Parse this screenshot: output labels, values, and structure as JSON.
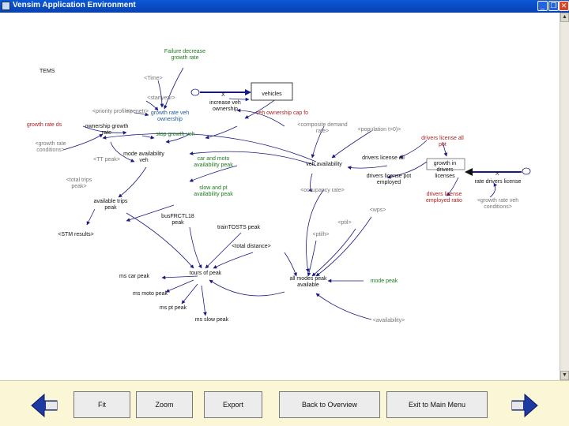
{
  "window": {
    "title": "Vensim Application Environment",
    "controls": [
      "_",
      "❐",
      "✕"
    ]
  },
  "model": {
    "title": "TEMS",
    "labels": {
      "failure_decrease": "Failure decrease\ngrowth rate",
      "time": "<Time>",
      "startyear": "<startyear>",
      "priority_profile": "<priority profile>",
      "growth_rate_veh": "growth rate veh\nownership",
      "penetr": "<penetr>",
      "stop_growth": "stop growth veh",
      "growth_rate_ds": "growth rate ds",
      "growth_rate_conditions": "<growth rate\nconditions>",
      "increase_veh": "increase veh\nownership",
      "vehicles": "vehicles",
      "veh_ownership": "veh ownership cap fo",
      "ownership_growth": "ownership growth\nrate",
      "composite_demand": "<composite demand\nrate>",
      "population": "<population t>0)>",
      "mode_availability": "mode availability\nveh",
      "car_and_moto": "car and moto\navailability peak",
      "slow_and_pt": "slow and pt\navailability peak",
      "tt_peak": "<TT peak>",
      "veh_availability": "veh availability",
      "drivers_license_all": "drivers license all",
      "drivers_license_pot": "drivers license pot\nemployed",
      "occupancy_rate": "<occupancy rate>",
      "drivers_license_total": "drivers license all\npot",
      "growth_drivers_licenses": "growth in\ndrivers\nlicenses",
      "rate_drivers_license": "rate drivers license",
      "drivers_license_employed": "drivers license\nemployed ratio",
      "growth_rate_veh_conditions": "<growth rate veh\nconditions>",
      "total_trips_peak": "<total trips\npeak>",
      "available_trips_peak": "available trips\npeak",
      "stm_results": "<STM results>",
      "bus_frc": "busFRCTL18\npeak",
      "train_peak": "trainTOSTS peak",
      "total_distance": "<total distance>",
      "tours_peak": "tours of peak",
      "wps": "<wps>",
      "ptil": "<ptil>",
      "ptilh": "<ptilh>",
      "all_modes_peak": "all modes peak\navailable",
      "mode_peak": "mode peak",
      "availability": "<availability>",
      "mscar_peak": "ms car peak",
      "msmoto_peak": "ms moto peak",
      "mspt_peak": "ms pt peak",
      "msslow_peak": "ms slow peak",
      "xmark": "X"
    }
  },
  "toolbar": {
    "back_arrow": "back",
    "fit": "Fit",
    "zoom": "Zoom",
    "export": "Export",
    "back_to_overview": "Back to Overview",
    "exit_to_main": "Exit to Main Menu",
    "forward_arrow": "forward"
  },
  "colors": {
    "title_bar": "#0a58d8",
    "arrow": "#1a1a80",
    "label_dark": "#111111",
    "label_gray": "#777777",
    "label_green": "#1e7a1e",
    "label_red": "#b02020",
    "label_blue": "#1a5aa8",
    "toolbar_bg": "#fbf6d6",
    "nav_arrow": "#1e3aa0"
  }
}
